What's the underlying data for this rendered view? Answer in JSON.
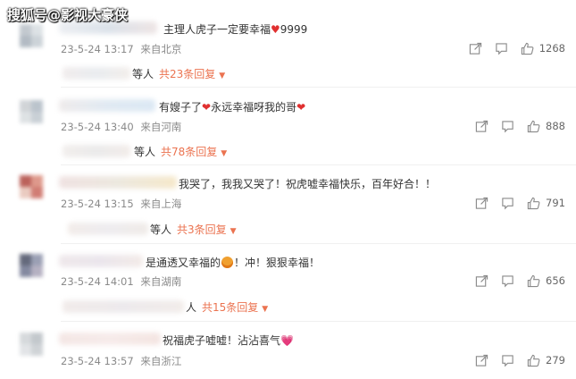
{
  "watermark": "搜狐号@影视大豪侠",
  "comments": [
    {
      "text": "主理人虎子一定要幸福",
      "text_suffix": "9999",
      "date": "23-5-24 13:17",
      "location": "来自北京",
      "likes": "1268",
      "replies_prefix": "等人",
      "replies_link": "共23条回复"
    },
    {
      "text": "有嫂子了",
      "text_suffix": "永远幸福呀我的哥",
      "date": "23-5-24 13:40",
      "location": "来自河南",
      "likes": "888",
      "replies_prefix": "等人",
      "replies_link": "共78条回复"
    },
    {
      "text": "我哭了，我我又哭了！祝虎嘘幸福快乐，百年好合！！",
      "date": "23-5-24 13:15",
      "location": "来自上海",
      "likes": "791",
      "replies_prefix": "等人",
      "replies_link": "共3条回复"
    },
    {
      "text": "是通透又幸福的",
      "text_suffix": "！冲！狠狠幸福！",
      "date": "23-5-24 14:01",
      "location": "来自湖南",
      "likes": "656",
      "replies_prefix": "人",
      "replies_link": "共15条回复"
    },
    {
      "text": "祝福虎子嘘嘘！沾沾喜气",
      "date": "23-5-24 13:57",
      "location": "来自浙江",
      "likes": "279"
    }
  ],
  "icons": {
    "share": "share-icon",
    "comment": "comment-icon",
    "like": "thumbs-up-icon",
    "heart": "heart-icon",
    "tiger": "tiger-face-icon",
    "chevron": "chevron-down-icon"
  },
  "colors": {
    "link": "#eb7350",
    "heart": "#e03030",
    "meta": "#8a8a8a"
  }
}
